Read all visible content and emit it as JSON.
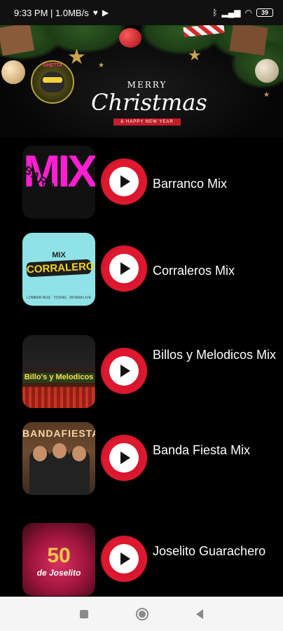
{
  "status_bar": {
    "time_speed": "9:33 PM | 1.0MB/s",
    "heart_icon": "heart-icon",
    "youtube_icon": "youtube-icon",
    "bluetooth_icon": "bluetooth-icon",
    "signal_icon": "signal-icon",
    "wifi_icon": "wifi-icon",
    "battery": "39"
  },
  "banner": {
    "logo_text": "GHETTA",
    "merry": "MERRY",
    "christmas": "Christmas",
    "ribbon": "& HAPPY NEW YEAR"
  },
  "items": [
    {
      "title": "Barranco Mix",
      "thumb_text": "MIX",
      "thumb_sub": "BARRANCO"
    },
    {
      "title": "Corraleros Mix",
      "thumb_text": "MIX",
      "thumb_sub": "CORRALERO",
      "thumb_small": "LOMBAR RUIZ · YOUNG · RIVERA LIVE"
    },
    {
      "title": "Billos y Melodicos Mix",
      "thumb_text": "Billo's y Melodicos"
    },
    {
      "title": "Banda Fiesta Mix",
      "thumb_text": "BANDAFIESTA"
    },
    {
      "title": "Joselito Guarachero",
      "thumb_text": "50",
      "thumb_sub": "de Joselito"
    }
  ],
  "navbar": {
    "recent": "recent-apps-icon",
    "home": "home-icon",
    "back": "back-icon"
  },
  "colors": {
    "play_red": "#e0192f",
    "background": "#000000",
    "navbar": "#f5f5f5"
  }
}
